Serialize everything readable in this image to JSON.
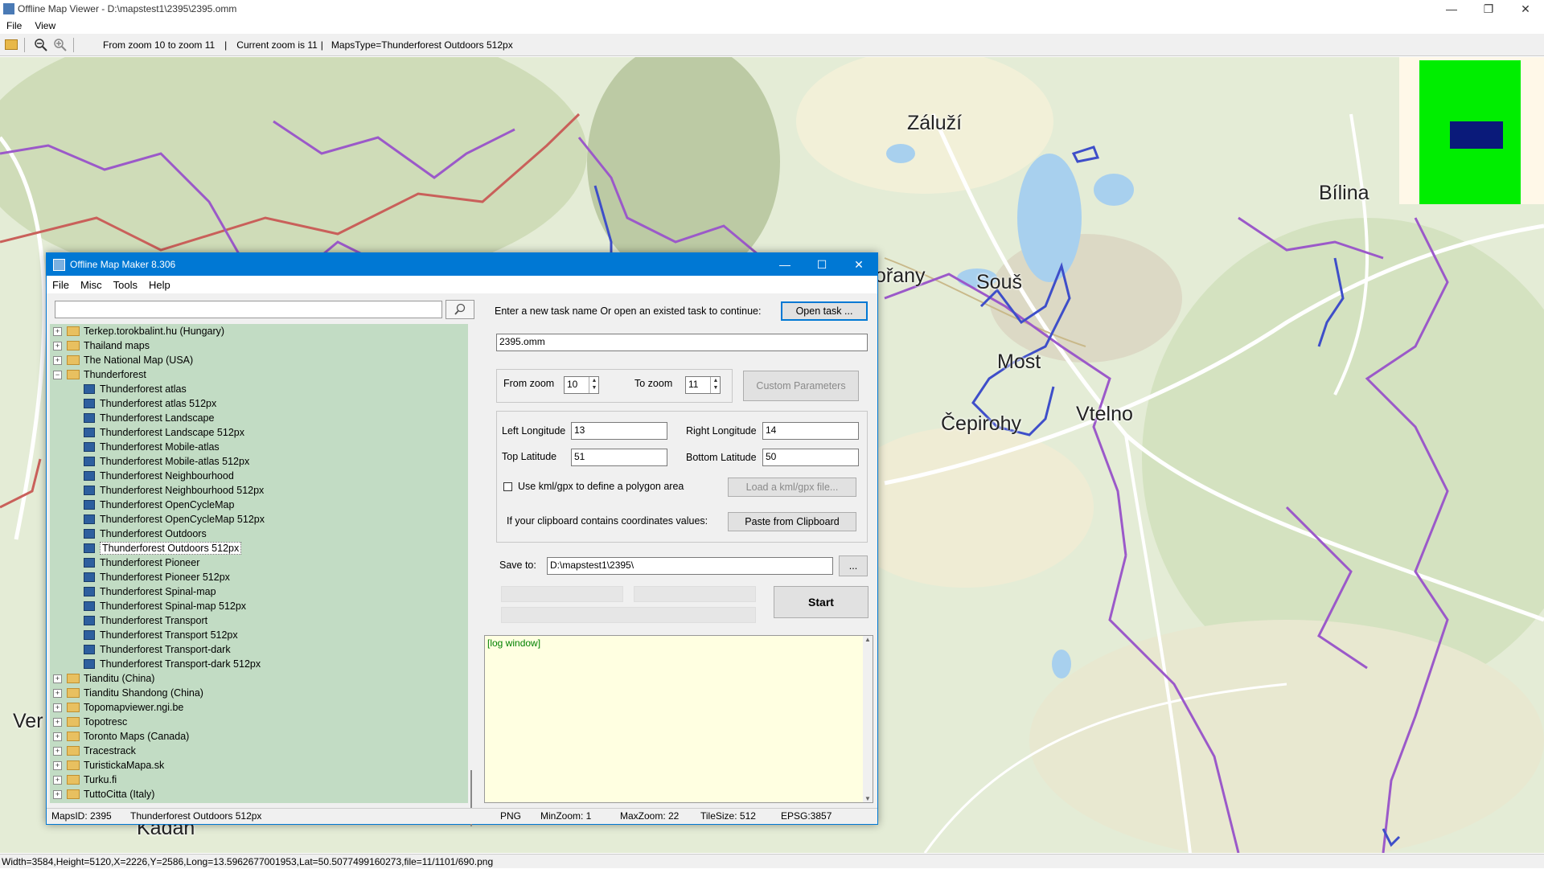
{
  "viewer": {
    "title": "Offline Map Viewer - D:\\mapstest1\\2395\\2395.omm",
    "menu": [
      "File",
      "View"
    ],
    "toolbar": {
      "zoom_range": "From zoom 10 to zoom 11",
      "current_zoom": "Current zoom is 11",
      "maps_type": "MapsType=Thunderforest Outdoors 512px",
      "sep1": "|",
      "sep2": "|"
    },
    "status": "Width=3584,Height=5120,X=2226,Y=2586,Long=13.5962677001953,Lat=50.5077499160273,file=11/1101/690.png",
    "cities": [
      "Záluží",
      "Bílina",
      "ořany",
      "Souš",
      "Most",
      "Čepirohy",
      "Vtelno",
      "Ver",
      "Kadan"
    ]
  },
  "maker": {
    "title": "Offline Map Maker 8.306",
    "menu": [
      "File",
      "Misc",
      "Tools",
      "Help"
    ],
    "search": {
      "value": ""
    },
    "tree": {
      "items": [
        {
          "label": "Terkep.torokbalint.hu (Hungary)",
          "level": 0,
          "expander": "+"
        },
        {
          "label": "Thailand maps",
          "level": 0,
          "expander": "+"
        },
        {
          "label": "The National Map (USA)",
          "level": 0,
          "expander": "+"
        },
        {
          "label": "Thunderforest",
          "level": 0,
          "expander": "−"
        },
        {
          "label": "Thunderforest atlas",
          "level": 1
        },
        {
          "label": "Thunderforest atlas 512px",
          "level": 1
        },
        {
          "label": "Thunderforest Landscape",
          "level": 1
        },
        {
          "label": "Thunderforest Landscape 512px",
          "level": 1
        },
        {
          "label": "Thunderforest Mobile-atlas",
          "level": 1
        },
        {
          "label": "Thunderforest Mobile-atlas 512px",
          "level": 1
        },
        {
          "label": "Thunderforest Neighbourhood",
          "level": 1
        },
        {
          "label": "Thunderforest Neighbourhood 512px",
          "level": 1
        },
        {
          "label": "Thunderforest OpenCycleMap",
          "level": 1
        },
        {
          "label": "Thunderforest OpenCycleMap 512px",
          "level": 1
        },
        {
          "label": "Thunderforest Outdoors",
          "level": 1
        },
        {
          "label": "Thunderforest Outdoors 512px",
          "level": 1,
          "selected": true
        },
        {
          "label": "Thunderforest Pioneer",
          "level": 1
        },
        {
          "label": "Thunderforest Pioneer 512px",
          "level": 1
        },
        {
          "label": "Thunderforest Spinal-map",
          "level": 1
        },
        {
          "label": "Thunderforest Spinal-map 512px",
          "level": 1
        },
        {
          "label": "Thunderforest Transport",
          "level": 1
        },
        {
          "label": "Thunderforest Transport 512px",
          "level": 1
        },
        {
          "label": "Thunderforest Transport-dark",
          "level": 1
        },
        {
          "label": "Thunderforest Transport-dark 512px",
          "level": 1
        },
        {
          "label": "Tianditu (China)",
          "level": 0,
          "expander": "+"
        },
        {
          "label": "Tianditu Shandong (China)",
          "level": 0,
          "expander": "+"
        },
        {
          "label": "Topomapviewer.ngi.be",
          "level": 0,
          "expander": "+"
        },
        {
          "label": "Topotresc",
          "level": 0,
          "expander": "+"
        },
        {
          "label": "Toronto Maps (Canada)",
          "level": 0,
          "expander": "+"
        },
        {
          "label": "Tracestrack",
          "level": 0,
          "expander": "+"
        },
        {
          "label": "TuristickaMapa.sk",
          "level": 0,
          "expander": "+"
        },
        {
          "label": "Turku.fi",
          "level": 0,
          "expander": "+"
        },
        {
          "label": "TuttoCitta (Italy)",
          "level": 0,
          "expander": "+"
        }
      ]
    },
    "task": {
      "prompt": "Enter a new task name Or open an existed task to continue:",
      "open_label": "Open task ...",
      "name_value": "2395.omm"
    },
    "zoom": {
      "from_label": "From zoom",
      "from_value": "10",
      "to_label": "To zoom",
      "to_value": "11",
      "custom_label": "Custom Parameters"
    },
    "coords": {
      "left_label": "Left Longitude",
      "left_value": "13",
      "right_label": "Right Longitude",
      "right_value": "14",
      "top_label": "Top Latitude",
      "top_value": "51",
      "bottom_label": "Bottom Latitude",
      "bottom_value": "50",
      "kml_label": "Use kml/gpx to define a polygon area",
      "kml_button": "Load a kml/gpx file...",
      "clipboard_label": "If your clipboard contains coordinates values:",
      "clipboard_button": "Paste from Clipboard"
    },
    "save": {
      "label": "Save to:",
      "value": "D:\\mapstest1\\2395\\",
      "browse": "..."
    },
    "start_label": "Start",
    "log_text": "[log window]",
    "status": {
      "maps_id": "MapsID: 2395",
      "maps_name": "Thunderforest Outdoors 512px",
      "format": "PNG",
      "min_zoom": "MinZoom: 1",
      "max_zoom": "MaxZoom: 22",
      "tile_size": "TileSize: 512",
      "epsg": "EPSG:3857"
    }
  }
}
